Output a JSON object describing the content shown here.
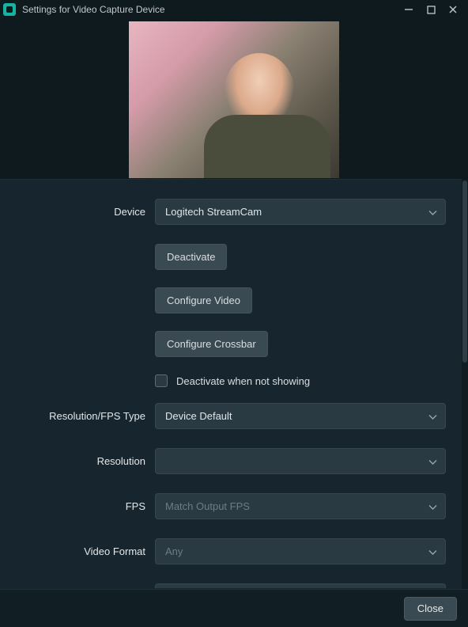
{
  "window": {
    "title": "Settings for Video Capture Device"
  },
  "form": {
    "device": {
      "label": "Device",
      "value": "Logitech StreamCam"
    },
    "deactivate_btn": "Deactivate",
    "configure_video_btn": "Configure Video",
    "configure_crossbar_btn": "Configure Crossbar",
    "deactivate_not_showing": {
      "label": "Deactivate when not showing",
      "checked": false
    },
    "res_fps_type": {
      "label": "Resolution/FPS Type",
      "value": "Device Default"
    },
    "resolution": {
      "label": "Resolution",
      "value": ""
    },
    "fps": {
      "label": "FPS",
      "value": "Match Output FPS"
    },
    "video_format": {
      "label": "Video Format",
      "value": "Any"
    }
  },
  "footer": {
    "close": "Close"
  }
}
